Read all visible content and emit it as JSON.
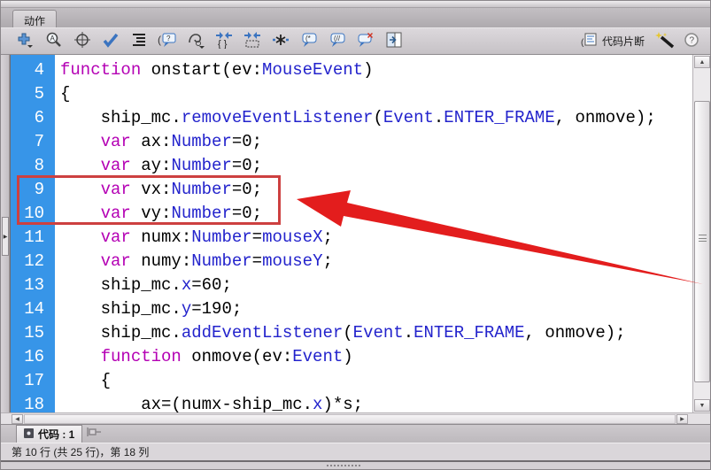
{
  "panel": {
    "title": "动作"
  },
  "toolbar": {
    "icons": [
      "add-item-icon",
      "find-icon",
      "insert-target-path-icon",
      "check-syntax-icon",
      "auto-format-icon",
      "show-code-hint-icon",
      "debug-options-icon",
      "collapse-between-braces-icon",
      "collapse-selection-icon",
      "expand-all-icon",
      "apply-block-comment-icon",
      "apply-line-comment-icon",
      "remove-comment-icon",
      "show-hide-toolbox-icon"
    ],
    "code_snippets_label": "代码片断",
    "wand_icon": "script-assist-wand-icon",
    "help_icon": "help-icon"
  },
  "editor": {
    "lines": [
      {
        "n": "4",
        "s": [
          {
            "t": "function",
            "c": "k"
          },
          {
            "t": " onstart(ev:",
            "c": "p"
          },
          {
            "t": "MouseEvent",
            "c": "b"
          },
          {
            "t": ")",
            "c": "p"
          }
        ]
      },
      {
        "n": "5",
        "s": [
          {
            "t": "{",
            "c": "p"
          }
        ]
      },
      {
        "n": "6",
        "s": [
          {
            "t": "    ship_mc.",
            "c": "p"
          },
          {
            "t": "removeEventListener",
            "c": "b"
          },
          {
            "t": "(",
            "c": "p"
          },
          {
            "t": "Event",
            "c": "b"
          },
          {
            "t": ".",
            "c": "p"
          },
          {
            "t": "ENTER_FRAME",
            "c": "b"
          },
          {
            "t": ", onmove);",
            "c": "p"
          }
        ]
      },
      {
        "n": "7",
        "s": [
          {
            "t": "    ",
            "c": "p"
          },
          {
            "t": "var",
            "c": "k"
          },
          {
            "t": " ax:",
            "c": "p"
          },
          {
            "t": "Number",
            "c": "b"
          },
          {
            "t": "=0;",
            "c": "p"
          }
        ]
      },
      {
        "n": "8",
        "s": [
          {
            "t": "    ",
            "c": "p"
          },
          {
            "t": "var",
            "c": "k"
          },
          {
            "t": " ay:",
            "c": "p"
          },
          {
            "t": "Number",
            "c": "b"
          },
          {
            "t": "=0;",
            "c": "p"
          }
        ]
      },
      {
        "n": "9",
        "s": [
          {
            "t": "    ",
            "c": "p"
          },
          {
            "t": "var",
            "c": "k"
          },
          {
            "t": " vx:",
            "c": "p"
          },
          {
            "t": "Number",
            "c": "b"
          },
          {
            "t": "=0;",
            "c": "p"
          }
        ]
      },
      {
        "n": "10",
        "s": [
          {
            "t": "    ",
            "c": "p"
          },
          {
            "t": "var",
            "c": "k"
          },
          {
            "t": " vy:",
            "c": "p"
          },
          {
            "t": "Number",
            "c": "b"
          },
          {
            "t": "=0;",
            "c": "p"
          }
        ]
      },
      {
        "n": "11",
        "s": [
          {
            "t": "    ",
            "c": "p"
          },
          {
            "t": "var",
            "c": "k"
          },
          {
            "t": " numx:",
            "c": "p"
          },
          {
            "t": "Number",
            "c": "b"
          },
          {
            "t": "=",
            "c": "p"
          },
          {
            "t": "mouseX",
            "c": "b"
          },
          {
            "t": ";",
            "c": "p"
          }
        ]
      },
      {
        "n": "12",
        "s": [
          {
            "t": "    ",
            "c": "p"
          },
          {
            "t": "var",
            "c": "k"
          },
          {
            "t": " numy:",
            "c": "p"
          },
          {
            "t": "Number",
            "c": "b"
          },
          {
            "t": "=",
            "c": "p"
          },
          {
            "t": "mouseY",
            "c": "b"
          },
          {
            "t": ";",
            "c": "p"
          }
        ]
      },
      {
        "n": "13",
        "s": [
          {
            "t": "    ship_mc.",
            "c": "p"
          },
          {
            "t": "x",
            "c": "b"
          },
          {
            "t": "=60;",
            "c": "p"
          }
        ]
      },
      {
        "n": "14",
        "s": [
          {
            "t": "    ship_mc.",
            "c": "p"
          },
          {
            "t": "y",
            "c": "b"
          },
          {
            "t": "=190;",
            "c": "p"
          }
        ]
      },
      {
        "n": "15",
        "s": [
          {
            "t": "    ship_mc.",
            "c": "p"
          },
          {
            "t": "addEventListener",
            "c": "b"
          },
          {
            "t": "(",
            "c": "p"
          },
          {
            "t": "Event",
            "c": "b"
          },
          {
            "t": ".",
            "c": "p"
          },
          {
            "t": "ENTER_FRAME",
            "c": "b"
          },
          {
            "t": ", onmove);",
            "c": "p"
          }
        ]
      },
      {
        "n": "16",
        "s": [
          {
            "t": "    ",
            "c": "p"
          },
          {
            "t": "function",
            "c": "k"
          },
          {
            "t": " onmove(ev:",
            "c": "p"
          },
          {
            "t": "Event",
            "c": "b"
          },
          {
            "t": ")",
            "c": "p"
          }
        ]
      },
      {
        "n": "17",
        "s": [
          {
            "t": "    {",
            "c": "p"
          }
        ]
      },
      {
        "n": "18",
        "s": [
          {
            "t": "        ax=(numx-ship_mc.",
            "c": "p"
          },
          {
            "t": "x",
            "c": "b"
          },
          {
            "t": ")*s;",
            "c": "p"
          }
        ]
      }
    ],
    "annotation": {
      "highlighted_lines": "9-10",
      "shape": "red box with red arrow pointing at lines 9 and 10"
    }
  },
  "script_tab": {
    "label": "代码 : 1"
  },
  "status_bar": {
    "text": "第 10 行 (共 25 行)，第 18 列"
  },
  "colors": {
    "gutter": "#3795e8",
    "keyword": "#b400b4",
    "builtin": "#2323cc",
    "plain": "#000000",
    "boxred": "#cd4040",
    "arrowred": "#e31d1d"
  }
}
